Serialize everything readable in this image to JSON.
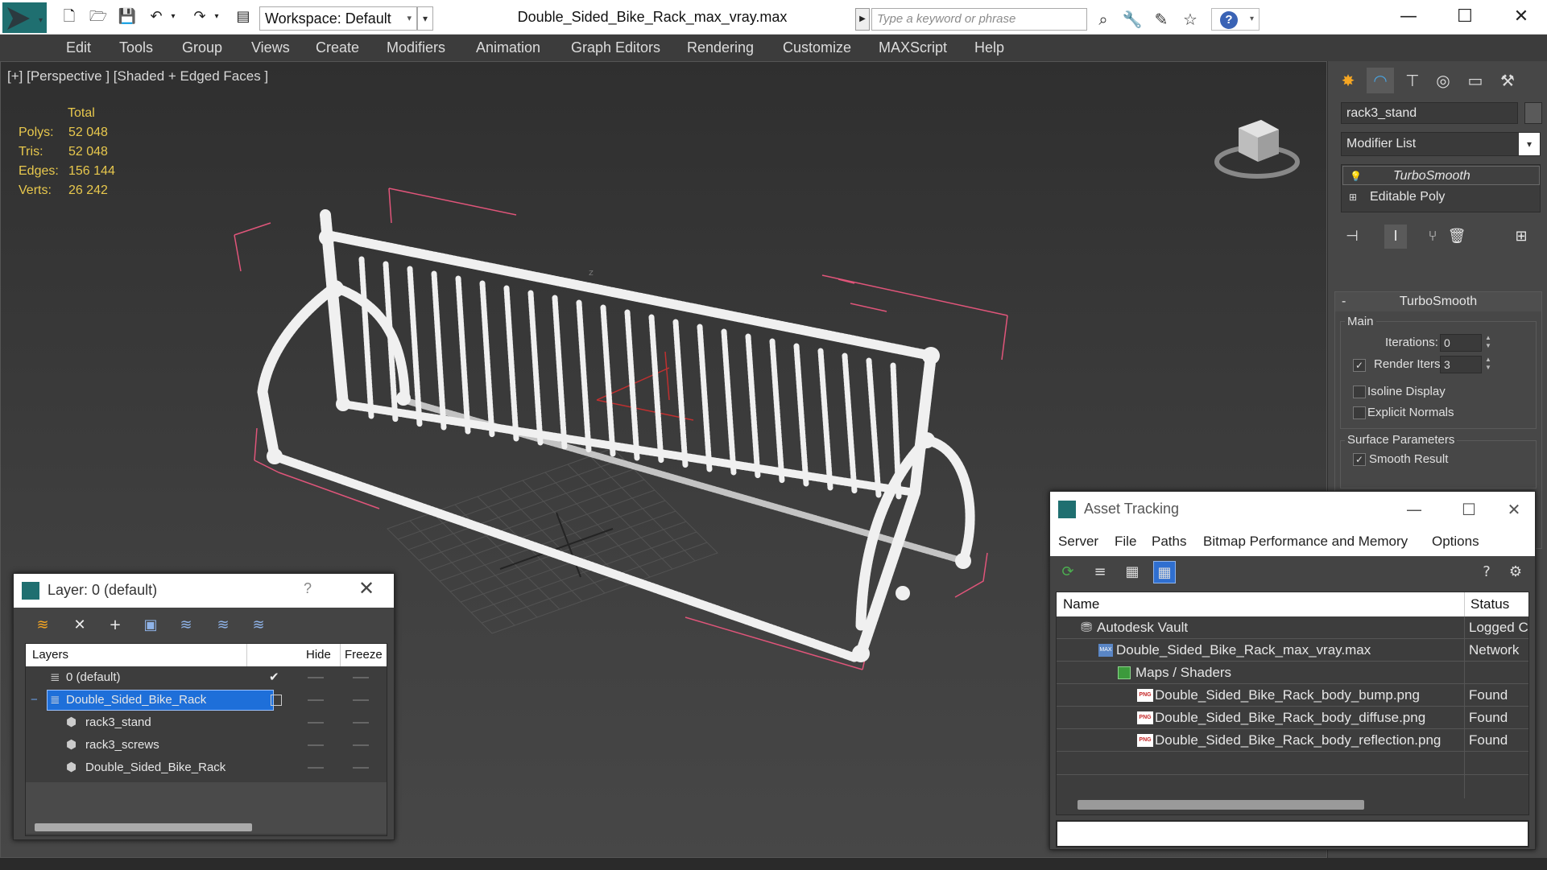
{
  "titlebar": {
    "workspace_label": "Workspace: Default",
    "file_title": "Double_Sided_Bike_Rack_max_vray.max",
    "search_placeholder": "Type a keyword or phrase"
  },
  "menubar": {
    "items": [
      "Edit",
      "Tools",
      "Group",
      "Views",
      "Create",
      "Modifiers",
      "Animation",
      "Graph Editors",
      "Rendering",
      "Customize",
      "MAXScript",
      "Help"
    ]
  },
  "viewport": {
    "label": "[+] [Perspective ] [Shaded + Edged Faces ]",
    "stats": {
      "header": "Total",
      "rows": [
        {
          "key": "Polys:",
          "value": "52 048"
        },
        {
          "key": "Tris:",
          "value": "52 048"
        },
        {
          "key": "Edges:",
          "value": "156 144"
        },
        {
          "key": "Verts:",
          "value": "26 242"
        }
      ]
    },
    "axis_label": "z"
  },
  "command_panel": {
    "object_name": "rack3_stand",
    "modifier_list": "Modifier List",
    "stack": [
      "TurboSmooth",
      "Editable Poly"
    ],
    "rollout": {
      "title": "TurboSmooth",
      "collapse": "-",
      "main_group": "Main",
      "iterations_label": "Iterations:",
      "iterations_value": "0",
      "render_iters_label": "Render Iters:",
      "render_iters_value": "3",
      "isoline_label": "Isoline Display",
      "explicit_normals_label": "Explicit Normals",
      "surface_group": "Surface Parameters",
      "smooth_result_label": "Smooth Result"
    }
  },
  "layer_dialog": {
    "title": "Layer: 0 (default)",
    "help": "?",
    "columns": {
      "layers": "Layers",
      "hide": "Hide",
      "freeze": "Freeze"
    },
    "rows": [
      {
        "name": "0 (default)"
      },
      {
        "name": "Double_Sided_Bike_Rack"
      },
      {
        "name": "rack3_stand"
      },
      {
        "name": "rack3_screws"
      },
      {
        "name": "Double_Sided_Bike_Rack"
      }
    ],
    "expand_toggle": "−"
  },
  "asset_tracking": {
    "title": "Asset Tracking",
    "menu": [
      "Server",
      "File",
      "Paths",
      "Bitmap Performance and Memory",
      "Options"
    ],
    "columns": {
      "name": "Name",
      "status": "Status"
    },
    "rows": [
      {
        "name": "Autodesk Vault",
        "status": "Logged C"
      },
      {
        "name": "Double_Sided_Bike_Rack_max_vray.max",
        "status": "Network"
      },
      {
        "name": "Maps / Shaders",
        "status": ""
      },
      {
        "name": "Double_Sided_Bike_Rack_body_bump.png",
        "status": "Found"
      },
      {
        "name": "Double_Sided_Bike_Rack_body_diffuse.png",
        "status": "Found"
      },
      {
        "name": "Double_Sided_Bike_Rack_body_reflection.png",
        "status": "Found"
      }
    ]
  },
  "colors": {
    "menubar_bg": "#3c3c3c",
    "viewport_bg": "#3a3a3a",
    "stats_text": "#e8c84d",
    "selection_blue": "#1e6fd9",
    "bbox_pink": "#e0557a",
    "mesh_white": "#f0f0f0"
  }
}
